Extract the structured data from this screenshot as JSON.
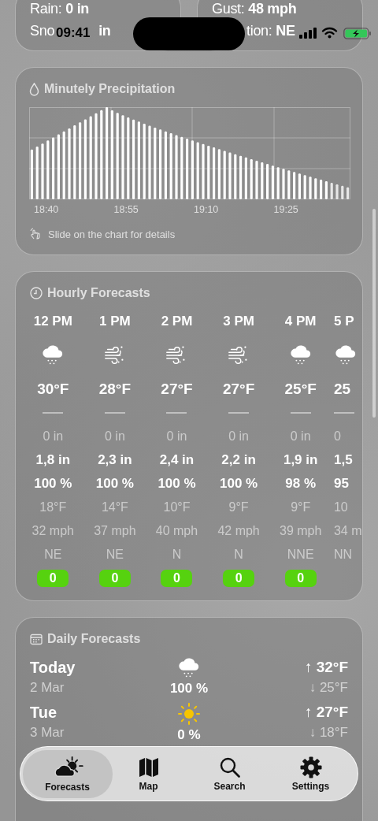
{
  "status_bar": {
    "time": "09:41"
  },
  "summary_cards": [
    {
      "lines": [
        [
          "Rain: **0 in**"
        ],
        [
          "Sno",
          "**in**"
        ]
      ]
    },
    {
      "lines": [
        [
          "Gust: **48 mph**"
        ],
        [
          "tion: **NE**"
        ]
      ]
    }
  ],
  "precipitation": {
    "title": "Minutely Precipitation",
    "time_labels": [
      "18:40",
      "18:55",
      "19:10",
      "19:25"
    ],
    "hint": "Slide on the chart for details"
  },
  "hourly": {
    "title": "Hourly Forecasts",
    "hours": [
      {
        "time": "12 PM",
        "kind": "snow",
        "temp": "30°F",
        "rain": "0 in",
        "snow": "1,8 in",
        "probability": "100 %",
        "dew_point": "18°F",
        "wind": "32 mph",
        "direction": "NE",
        "uv": "0"
      },
      {
        "time": "1 PM",
        "kind": "wind-snow",
        "temp": "28°F",
        "rain": "0 in",
        "snow": "2,3 in",
        "probability": "100 %",
        "dew_point": "14°F",
        "wind": "37 mph",
        "direction": "NE",
        "uv": "0"
      },
      {
        "time": "2 PM",
        "kind": "wind-snow",
        "temp": "27°F",
        "rain": "0 in",
        "snow": "2,4 in",
        "probability": "100 %",
        "dew_point": "10°F",
        "wind": "40 mph",
        "direction": "N",
        "uv": "0"
      },
      {
        "time": "3 PM",
        "kind": "wind-snow",
        "temp": "27°F",
        "rain": "0 in",
        "snow": "2,2 in",
        "probability": "100 %",
        "dew_point": "9°F",
        "wind": "42 mph",
        "direction": "N",
        "uv": "0"
      },
      {
        "time": "4 PM",
        "kind": "snow",
        "temp": "25°F",
        "rain": "0 in",
        "snow": "1,9 in",
        "probability": "98 %",
        "dew_point": "9°F",
        "wind": "39 mph",
        "direction": "NNE",
        "uv": "0"
      },
      {
        "time": "5 P",
        "kind": "snow",
        "temp": "25",
        "rain": "0",
        "snow": "1,5",
        "probability": "95",
        "dew_point": "10",
        "wind": "34 m",
        "direction": "NN"
      }
    ]
  },
  "daily": {
    "title": "Daily Forecasts",
    "days": [
      {
        "day": "Today",
        "date": "2 Mar",
        "kind": "snow",
        "probability": "100 %",
        "high": "↑ 32°F",
        "low": "↓ 25°F"
      },
      {
        "day": "Tue",
        "date": "3 Mar",
        "kind": "sun",
        "probability": "0 %",
        "high": "↑ 27°F",
        "low": "↓ 18°F"
      }
    ]
  },
  "tab_bar": {
    "tabs": [
      {
        "label": "Forecasts",
        "kind": "forecasts",
        "selected": true
      },
      {
        "label": "Map",
        "kind": "map",
        "selected": false
      },
      {
        "label": "Search",
        "kind": "search",
        "selected": false
      },
      {
        "label": "Settings",
        "kind": "settings",
        "selected": false
      }
    ]
  }
}
